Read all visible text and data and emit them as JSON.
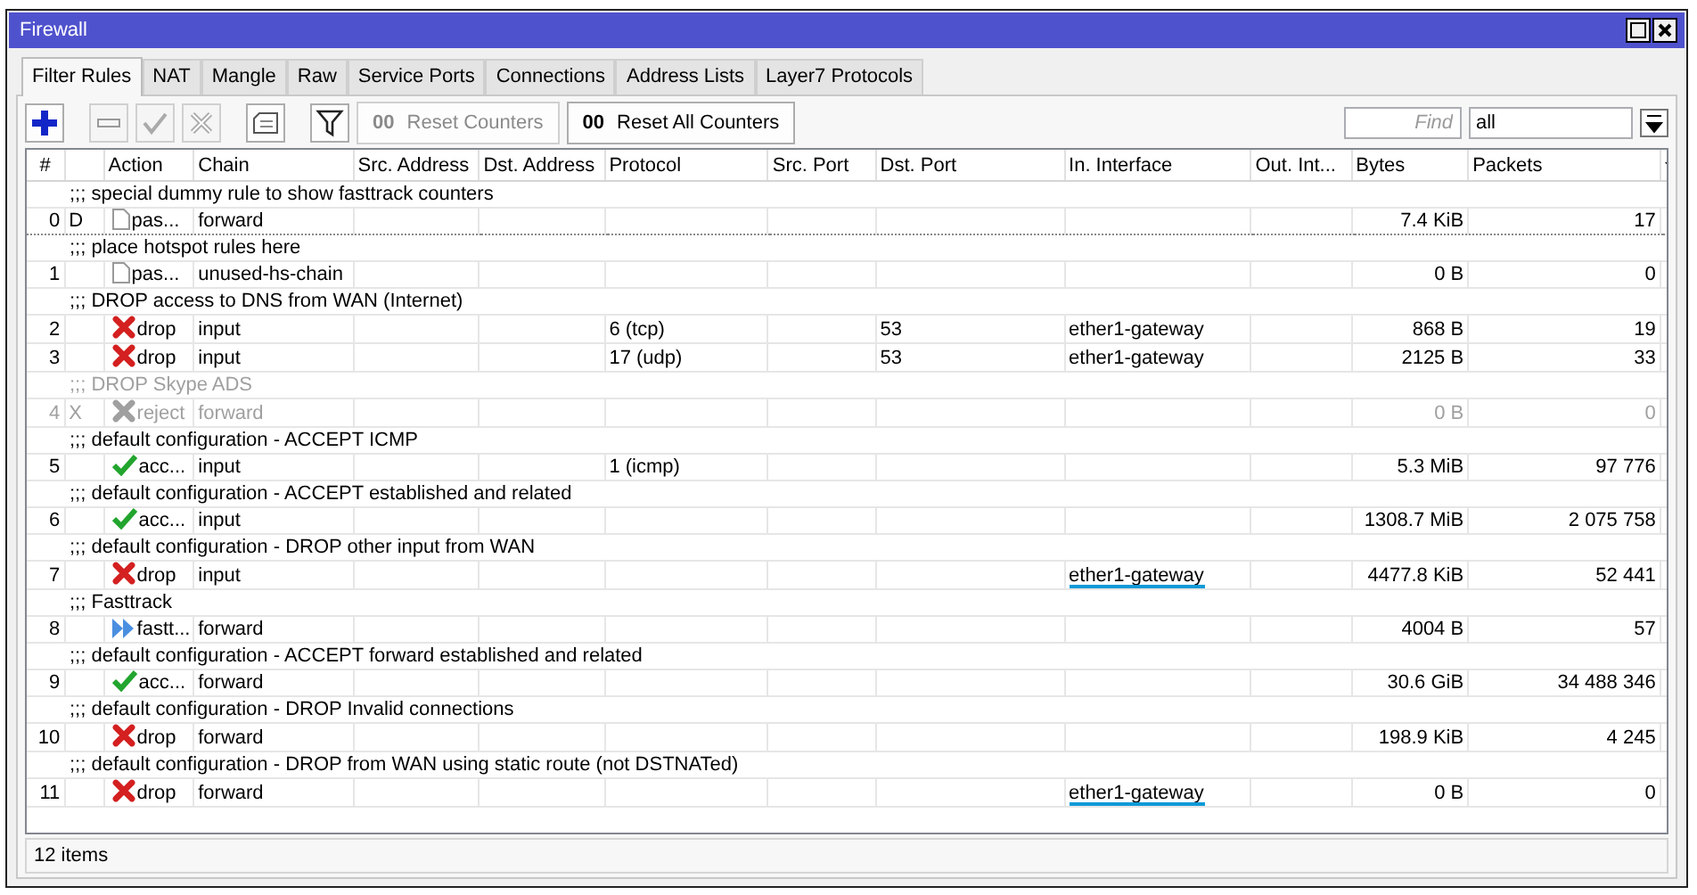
{
  "window": {
    "title": "Firewall"
  },
  "tabs": [
    {
      "label": "Filter Rules",
      "selected": true
    },
    {
      "label": "NAT",
      "selected": false
    },
    {
      "label": "Mangle",
      "selected": false
    },
    {
      "label": "Raw",
      "selected": false
    },
    {
      "label": "Service Ports",
      "selected": false
    },
    {
      "label": "Connections",
      "selected": false
    },
    {
      "label": "Address Lists",
      "selected": false
    },
    {
      "label": "Layer7 Protocols",
      "selected": false
    }
  ],
  "toolbar": {
    "icon_buttons": [
      {
        "kind": "add",
        "disabled": false
      },
      {
        "kind": "remove",
        "disabled": true
      },
      {
        "kind": "enable",
        "disabled": true
      },
      {
        "kind": "disable",
        "disabled": true
      },
      {
        "kind": "comment",
        "disabled": false
      },
      {
        "kind": "filter",
        "disabled": false
      }
    ],
    "text_buttons": [
      {
        "glyph": "00",
        "label": "Reset Counters",
        "disabled": true
      },
      {
        "glyph": "00",
        "label": "Reset All Counters",
        "disabled": false
      }
    ],
    "find": {
      "placeholder": "Find"
    },
    "scope": {
      "value": "all"
    }
  },
  "table": {
    "columns": [
      "#",
      "Action",
      "Chain",
      "Src. Address",
      "Dst. Address",
      "Protocol",
      "Src. Port",
      "Dst. Port",
      "In. Interface",
      "Out. Int...",
      "Bytes",
      "Packets"
    ],
    "rows": [
      {
        "comment": ";;; special dummy rule to show fasttrack counters",
        "number": "0",
        "flag": "D",
        "kind": "passthrough",
        "action": "pas...",
        "chain": "forward",
        "protocol": "",
        "dst_port": "",
        "in_interface": "",
        "bytes": "7.4 KiB",
        "packets": "17",
        "disabled": false,
        "focused": true,
        "underlined": false
      },
      {
        "comment": ";;; place hotspot rules here",
        "number": "1",
        "flag": "",
        "kind": "passthrough",
        "action": "pas...",
        "chain": "unused-hs-chain",
        "protocol": "",
        "dst_port": "",
        "in_interface": "",
        "bytes": "0 B",
        "packets": "0",
        "disabled": false,
        "focused": false,
        "underlined": false
      },
      {
        "comment": ";;; DROP access to DNS from WAN (Internet)",
        "number": "2",
        "flag": "",
        "kind": "drop",
        "action": "drop",
        "chain": "input",
        "protocol": "6 (tcp)",
        "dst_port": "53",
        "in_interface": "ether1-gateway",
        "bytes": "868 B",
        "packets": "19",
        "disabled": false,
        "focused": false,
        "underlined": false
      },
      {
        "comment": "",
        "number": "3",
        "flag": "",
        "kind": "drop",
        "action": "drop",
        "chain": "input",
        "protocol": "17 (udp)",
        "dst_port": "53",
        "in_interface": "ether1-gateway",
        "bytes": "2125 B",
        "packets": "33",
        "disabled": false,
        "focused": false,
        "underlined": false
      },
      {
        "comment": ";;; DROP Skype ADS",
        "number": "4",
        "flag": "X",
        "kind": "reject",
        "action": "reject",
        "chain": "forward",
        "protocol": "",
        "dst_port": "",
        "in_interface": "",
        "bytes": "0 B",
        "packets": "0",
        "disabled": true,
        "focused": false,
        "underlined": false
      },
      {
        "comment": ";;; default configuration - ACCEPT ICMP",
        "number": "5",
        "flag": "",
        "kind": "accept",
        "action": "acc...",
        "chain": "input",
        "protocol": "1 (icmp)",
        "dst_port": "",
        "in_interface": "",
        "bytes": "5.3 MiB",
        "packets": "97 776",
        "disabled": false,
        "focused": false,
        "underlined": false
      },
      {
        "comment": ";;; default configuration - ACCEPT established and related",
        "number": "6",
        "flag": "",
        "kind": "accept",
        "action": "acc...",
        "chain": "input",
        "protocol": "",
        "dst_port": "",
        "in_interface": "",
        "bytes": "1308.7 MiB",
        "packets": "2 075 758",
        "disabled": false,
        "focused": false,
        "underlined": false
      },
      {
        "comment": ";;; default configuration - DROP other input from WAN",
        "number": "7",
        "flag": "",
        "kind": "drop",
        "action": "drop",
        "chain": "input",
        "protocol": "",
        "dst_port": "",
        "in_interface": "ether1-gateway",
        "bytes": "4477.8 KiB",
        "packets": "52 441",
        "disabled": false,
        "focused": false,
        "underlined": true
      },
      {
        "comment": ";;; Fasttrack",
        "number": "8",
        "flag": "",
        "kind": "fasttrack",
        "action": "fastt...",
        "chain": "forward",
        "protocol": "",
        "dst_port": "",
        "in_interface": "",
        "bytes": "4004 B",
        "packets": "57",
        "disabled": false,
        "focused": false,
        "underlined": false
      },
      {
        "comment": ";;; default configuration - ACCEPT forward established and related",
        "number": "9",
        "flag": "",
        "kind": "accept",
        "action": "acc...",
        "chain": "forward",
        "protocol": "",
        "dst_port": "",
        "in_interface": "",
        "bytes": "30.6 GiB",
        "packets": "34 488 346",
        "disabled": false,
        "focused": false,
        "underlined": false
      },
      {
        "comment": ";;; default configuration - DROP Invalid connections",
        "number": "10",
        "flag": "",
        "kind": "drop",
        "action": "drop",
        "chain": "forward",
        "protocol": "",
        "dst_port": "",
        "in_interface": "",
        "bytes": "198.9 KiB",
        "packets": "4 245",
        "disabled": false,
        "focused": false,
        "underlined": false
      },
      {
        "comment": ";;; default configuration - DROP from WAN using static route (not DSTNATed)",
        "number": "11",
        "flag": "",
        "kind": "drop",
        "action": "drop",
        "chain": "forward",
        "protocol": "",
        "dst_port": "",
        "in_interface": "ether1-gateway",
        "bytes": "0 B",
        "packets": "0",
        "disabled": false,
        "focused": false,
        "underlined": true
      }
    ]
  },
  "status_bar": "12 items"
}
